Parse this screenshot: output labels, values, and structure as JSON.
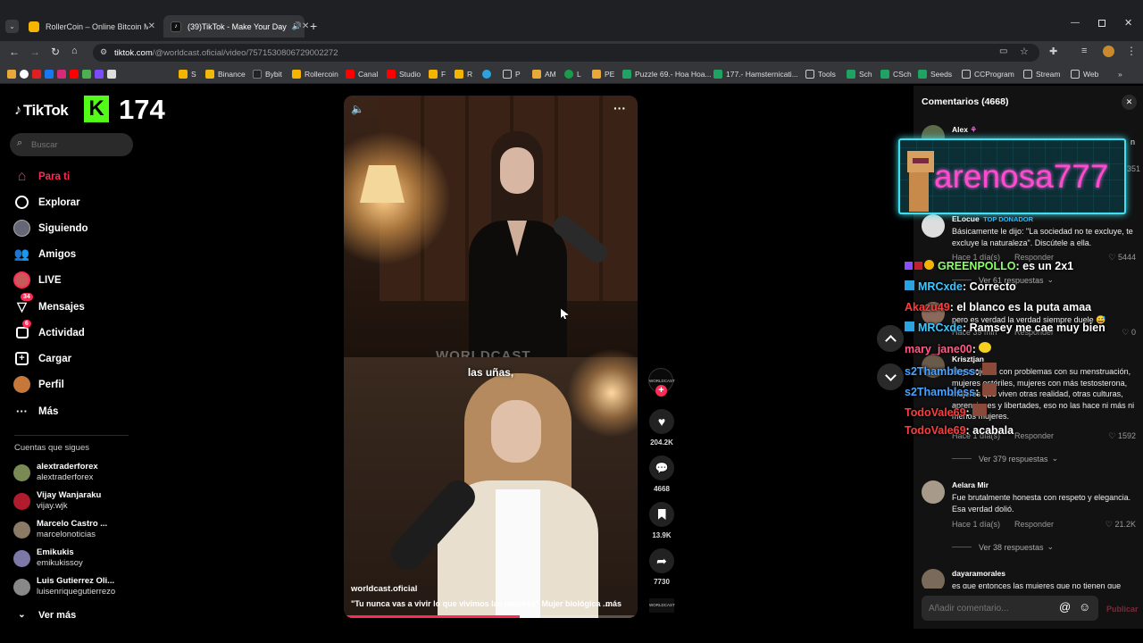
{
  "browser": {
    "tabs": [
      {
        "title": "RollerCoin – Online Bitcoin Mi"
      },
      {
        "title": "(39)TikTok - Make Your Day"
      }
    ],
    "url_host": "tiktok.com",
    "url_path": "/@worldcast.oficial/video/7571530806729002272",
    "bookmarks": [
      "S",
      "Binance",
      "Bybit",
      "Rollercoin",
      "Canal",
      "Studio",
      "F",
      "R",
      "P",
      "AM",
      "L",
      "PE",
      "Puzzle 69.- Hoa Hoa...",
      "177.- Hamsternicati...",
      "Tools",
      "Sch",
      "CSch",
      "Seeds",
      "CCProgram",
      "Stream",
      "Web"
    ]
  },
  "sidebar": {
    "logo": "TikTok",
    "kick_count": "174",
    "search_placeholder": "Buscar",
    "nav": [
      {
        "label": "Para ti",
        "icon": "home-icon"
      },
      {
        "label": "Explorar",
        "icon": "compass-icon"
      },
      {
        "label": "Siguiendo",
        "icon": "following-icon"
      },
      {
        "label": "Amigos",
        "icon": "friends-icon"
      },
      {
        "label": "LIVE",
        "icon": "live-icon"
      },
      {
        "label": "Mensajes",
        "icon": "messages-icon",
        "badge": "34"
      },
      {
        "label": "Actividad",
        "icon": "activity-icon",
        "badge": "6"
      },
      {
        "label": "Cargar",
        "icon": "upload-icon"
      },
      {
        "label": "Perfil",
        "icon": "profile-icon"
      },
      {
        "label": "Más",
        "icon": "more-icon"
      }
    ],
    "following_title": "Cuentas que sigues",
    "following": [
      {
        "name": "alextraderforex",
        "handle": "alextraderforex"
      },
      {
        "name": "Vijay Wanjaraku",
        "handle": "vijay.wjk"
      },
      {
        "name": "Marcelo Castro ...",
        "handle": "marcelonoticias"
      },
      {
        "name": "Emikukis",
        "handle": "emikukissoy"
      },
      {
        "name": "Luis Gutierrez Oli...",
        "handle": "luisenriquegutierrezo"
      }
    ],
    "see_more": "Ver más"
  },
  "video": {
    "watermark": "WORLDCAST.",
    "subtitle": "las uñas,",
    "author": "worldcast.oficial",
    "caption": "\"Tu nunca vas a vivir lo que vivimos las mujeres\" Mujer biológica ...",
    "more": "más",
    "progress": 0.6
  },
  "actions": {
    "likes": "204.2K",
    "comments": "4668",
    "saves": "13.9K",
    "shares": "7730"
  },
  "comments": {
    "title": "Comentarios (4668)",
    "items": [
      {
        "name": "Alex",
        "text": ""
      },
      {
        "name": "ELocue",
        "badge": "TOP DONADOR",
        "text": "Básicamente le dijo: \"La sociedad no te excluye, te excluye la naturaleza\". Discútele a ella.",
        "date": "Hace 1 día(s)",
        "reply": "Responder",
        "likes": "5444",
        "replies": "Ver 61 respuestas"
      },
      {
        "name": "",
        "text": "pero es verdad la verdad siempre duele",
        "date": "Hace 39 min",
        "reply": "Responder",
        "likes": "0"
      },
      {
        "name": "Krisztjan",
        "text": "Hay mujeres con problemas con su menstruación, mujeres estériles, mujeres con más testosterona, mujeres que viven otras realidad, otras culturas, aprenciones y libertades, eso no las hace ni más ni menos mujeres.",
        "date": "Hace 1 día(s)",
        "reply": "Responder",
        "likes": "1592",
        "replies": "Ver 379 respuestas"
      },
      {
        "name": "Aelara Mir",
        "text": "Fue brutalmente honesta con respeto y elegancia. Esa verdad dolió.",
        "date": "Hace 1 día(s)",
        "reply": "Responder",
        "likes": "21.2K",
        "replies": "Ver 38 respuestas"
      },
      {
        "name": "dayaramorales",
        "text": "es que entonces las mujeres que no tienen que"
      }
    ],
    "input_placeholder": "Añadir comentario...",
    "publish": "Publicar",
    "partial_right": [
      "n",
      "351"
    ]
  },
  "overlay": {
    "donor_name": "arenosa777",
    "chat": [
      {
        "user": "GREENPOLLO",
        "msg": ": es un 2x1"
      },
      {
        "user": "MRCxde",
        "msg": ": Correcto"
      },
      {
        "user": "Akazu49",
        "msg": ": el blanco es la puta amaa"
      },
      {
        "user": "MRCxde",
        "msg": ": Ramsey me cae muy bien"
      },
      {
        "user": "mary_jane00",
        "msg": ":"
      },
      {
        "user": "s2Thambless",
        "msg": ":"
      },
      {
        "user": "s2Thambless",
        "msg": ":"
      },
      {
        "user": "TodoVale69",
        "msg": ":"
      },
      {
        "user": "TodoVale69",
        "msg": ": acabala"
      }
    ]
  }
}
